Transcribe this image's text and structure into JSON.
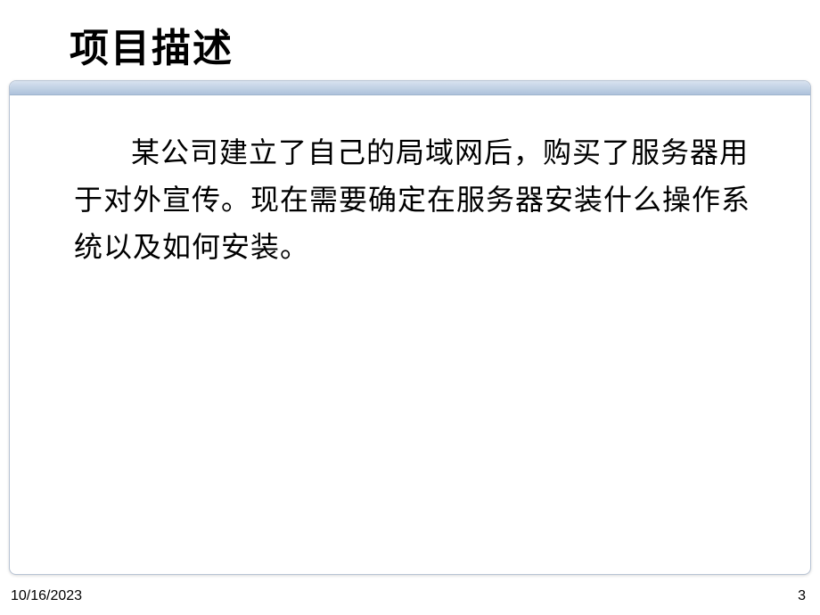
{
  "slide": {
    "title": "项目描述",
    "body": "某公司建立了自己的局域网后，购买了服务器用于对外宣传。现在需要确定在服务器安装什么操作系统以及如何安装。"
  },
  "footer": {
    "date": "10/16/2023",
    "page_number": "3"
  }
}
